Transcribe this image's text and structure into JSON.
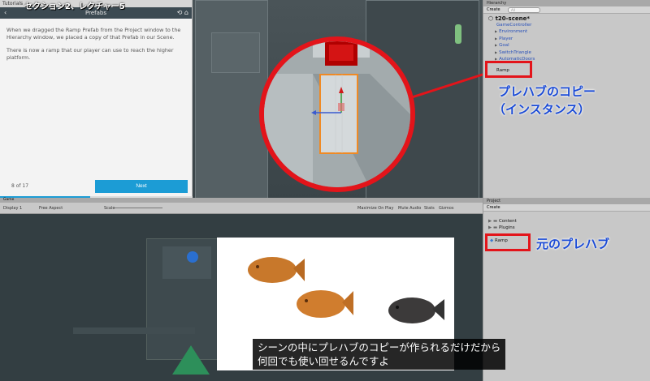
{
  "tutorial": {
    "window_title": "Tutorials",
    "header_title": "Prefabs",
    "section_overlay": "セクション2、レクチャー5",
    "paragraph1": "When we dragged the Ramp Prefab from the Project window to the Hierarchy window, we placed a copy of that Prefab in our Scene.",
    "paragraph2": "There is now a ramp that our player can use to reach the higher platform.",
    "progress_label": "8 of 17",
    "progress_fraction": 0.47,
    "next_label": "Next"
  },
  "hierarchy": {
    "tab_label": "Hierarchy",
    "create_label": "Create",
    "search_placeholder": "All",
    "scene_name": "t20-scene*",
    "items": [
      {
        "label": "GameController",
        "arrow": ""
      },
      {
        "label": "Environment",
        "arrow": "▶"
      },
      {
        "label": "Player",
        "arrow": "▶"
      },
      {
        "label": "Goal",
        "arrow": "▶"
      },
      {
        "label": "SwitchTriangle",
        "arrow": "▶"
      },
      {
        "label": "AutomaticDoors",
        "arrow": "▶"
      },
      {
        "label": "Ramp",
        "arrow": ""
      }
    ]
  },
  "project": {
    "tab_label": "Project",
    "create_label": "Create",
    "items": [
      {
        "label": "Content",
        "arrow": "▶"
      },
      {
        "label": "Plugins",
        "arrow": "▶"
      },
      {
        "label": "Ramp",
        "arrow": ""
      }
    ]
  },
  "game": {
    "tab_label": "Game",
    "display_label": "Display 1",
    "aspect_label": "Free Aspect",
    "scale_label": "Scale",
    "maximize_label": "Maximize On Play",
    "mute_label": "Mute Audio",
    "stats_label": "Stats",
    "gizmos_label": "Gizmos"
  },
  "annotations": {
    "prefab_copy_line1": "プレハブのコピー",
    "prefab_copy_line2": "（インスタンス）",
    "original_prefab": "元のプレハブ"
  },
  "subtitle": {
    "line1": "シーンの中にプレハブのコピーが作られるだけだから",
    "line2": "何回でも使い回せるんですよ"
  },
  "colors": {
    "annotation_red": "#e3141a",
    "annotation_blue": "#1b4bd6",
    "next_button_blue": "#1c9cd5"
  }
}
